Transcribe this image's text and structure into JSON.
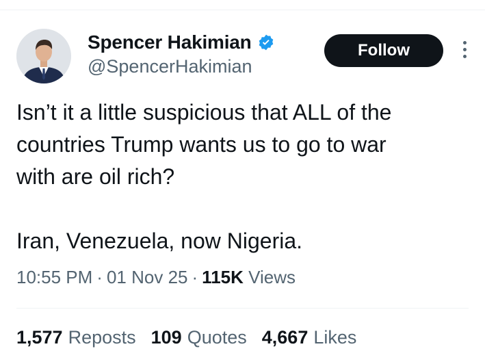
{
  "user": {
    "display_name": "Spencer Hakimian",
    "handle": "@SpencerHakimian",
    "verified": true
  },
  "actions": {
    "follow_label": "Follow",
    "more_icon": "more-vertical-icon"
  },
  "tweet": {
    "line1": "Isn’t it a little suspicious that ALL of the",
    "line2": "countries Trump wants us to go to war",
    "line3": "with are oil rich?",
    "line4": "Iran, Venezuela, now Nigeria."
  },
  "meta": {
    "time": "10:55 PM",
    "date": "01 Nov 25",
    "views_count": "115K",
    "views_label": "Views"
  },
  "stats": {
    "reposts_count": "1,577",
    "reposts_label": "Reposts",
    "quotes_count": "109",
    "quotes_label": "Quotes",
    "likes_count": "4,667",
    "likes_label": "Likes"
  },
  "colors": {
    "verified_blue": "#1d9bf0",
    "follow_bg": "#0f1419",
    "secondary_text": "#536471"
  }
}
